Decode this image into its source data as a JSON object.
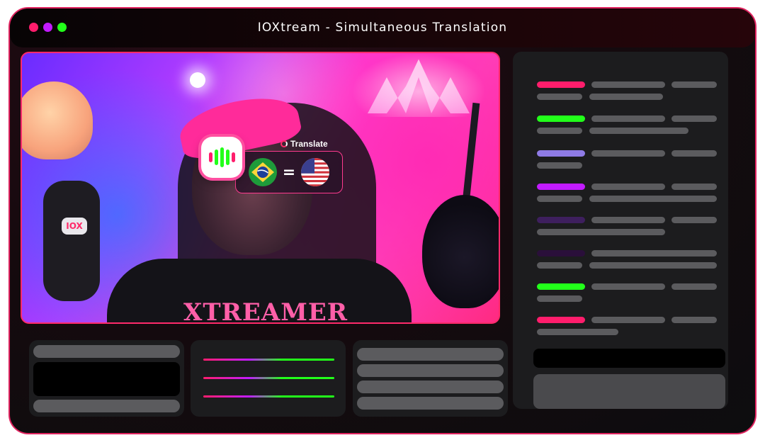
{
  "window": {
    "title": "IOXtream - Simultaneous Translation",
    "controls": [
      "close",
      "minimize",
      "maximize"
    ],
    "accent_color": "#ff1d6c"
  },
  "video": {
    "shirt_text": "XTREAMER",
    "mic_logo": "IOX",
    "translate_label": "Translate",
    "equals_sign": "=",
    "source_flag": "brazil-flag-icon",
    "target_flag": "usa-flag-icon"
  },
  "sidebar": {
    "entry_accent_colors": [
      "#ff1d6c",
      "#22ff1a",
      "#8f7be6",
      "#c21bff",
      "#3e1f5e",
      "#2a0f3a",
      "#22ff1a",
      "#ff1d6c"
    ]
  },
  "audio_panel": {
    "track_count": 3
  }
}
